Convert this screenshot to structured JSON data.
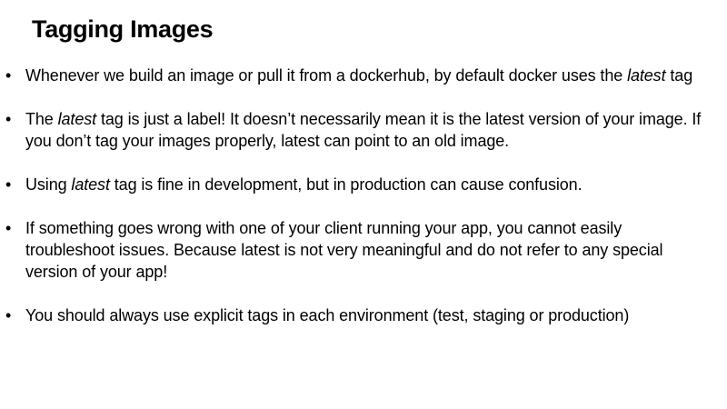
{
  "slide": {
    "title": "Tagging Images",
    "bullet_char": "•",
    "bullets": [
      {
        "p1": "Whenever we build an image or pull it from a dockerhub, by default docker uses the ",
        "em": "latest",
        "p2": " tag"
      },
      {
        "p1": "The ",
        "em": "latest",
        "p2": " tag is just a label! It doesn’t necessarily mean it is the latest version of your image. If you don’t tag your images properly, latest can point to an old image."
      },
      {
        "p1": "Using ",
        "em": "latest",
        "p2": " tag is fine in development, but in production can cause confusion."
      },
      {
        "text": "If something goes wrong with one of your client running your app, you cannot easily troubleshoot issues. Because latest is not very meaningful and do not refer to any special version of your app!"
      },
      {
        "text": "You should always use explicit tags in each environment (test, staging or production)"
      }
    ]
  }
}
